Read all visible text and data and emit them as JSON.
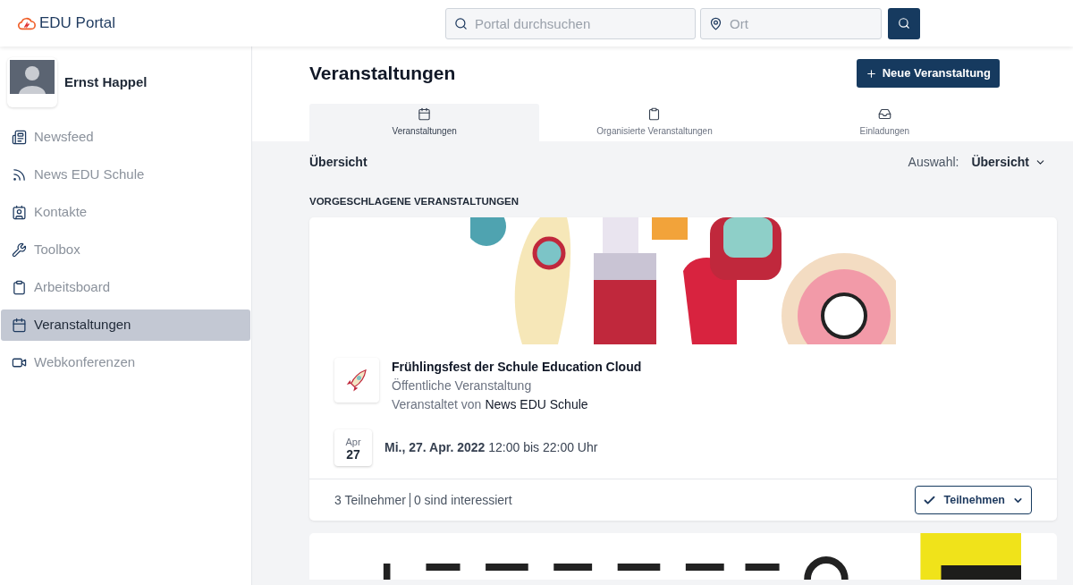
{
  "header": {
    "logo": "EDU Portal",
    "search": {
      "placeholder": "Portal durchsuchen"
    },
    "location": {
      "placeholder": "Ort"
    }
  },
  "user": {
    "name": "Ernst Happel"
  },
  "sidebar": {
    "items": [
      {
        "label": "Newsfeed",
        "kind": "news",
        "selected": false
      },
      {
        "label": "News EDU Schule",
        "kind": "rss",
        "selected": false
      },
      {
        "label": "Kontakte",
        "kind": "contact",
        "selected": false
      },
      {
        "label": "Toolbox",
        "kind": "wrench",
        "selected": false
      },
      {
        "label": "Arbeitsboard",
        "kind": "clipboard",
        "selected": false
      },
      {
        "label": "Veranstaltungen",
        "kind": "calendar",
        "selected": true
      },
      {
        "label": "Webkonferenzen",
        "kind": "video",
        "selected": false
      }
    ]
  },
  "page": {
    "title": "Veranstaltungen",
    "new_button": "Neue Veranstaltung"
  },
  "tabs": [
    {
      "label": "Veranstaltungen",
      "kind": "calendar",
      "selected": true
    },
    {
      "label": "Organisierte Veranstaltungen",
      "kind": "clipboard",
      "selected": false
    },
    {
      "label": "Einladungen",
      "kind": "inbox",
      "selected": false
    }
  ],
  "toolbar": {
    "title": "Übersicht",
    "select_label": "Auswahl:",
    "select_value": "Übersicht"
  },
  "section_title": "VORGESCHLAGENE VERANSTALTUNGEN",
  "events": [
    {
      "title": "Frühlingsfest der Schule Education Cloud",
      "visibility": "Öffentliche Veranstaltung",
      "organizer_prefix": "Veranstaltet von",
      "organizer": "News EDU Schule",
      "month": "Apr",
      "day": "27",
      "when": "**Mi., 27. Apr. 2022** 12:00 bis 22:00 Uhr",
      "participants": "3 Teilnehmer",
      "interested": "0 sind interessiert",
      "action": "Teilnehmen"
    }
  ]
}
